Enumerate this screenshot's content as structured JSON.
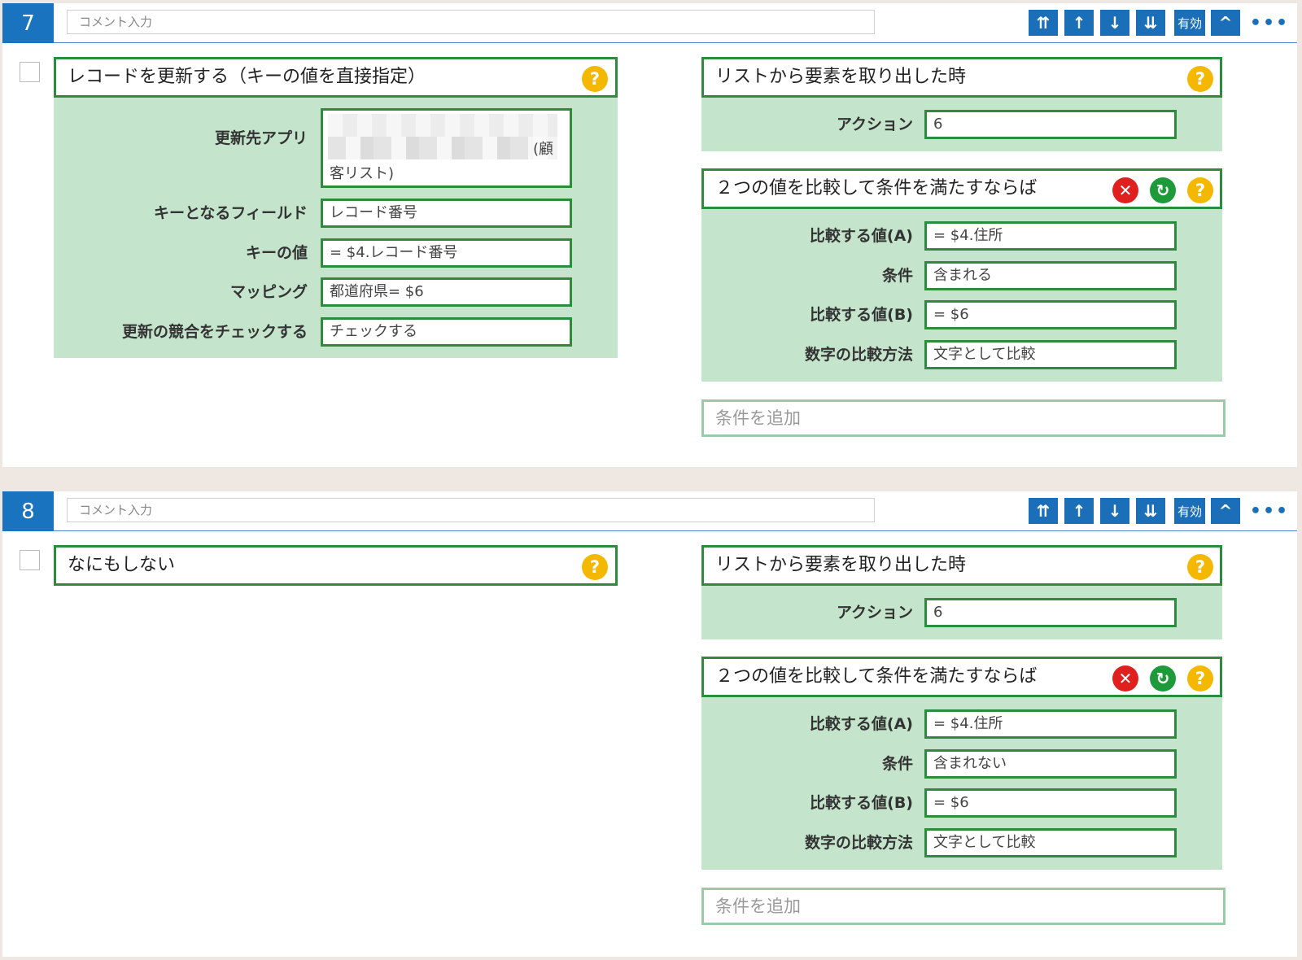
{
  "blocks": [
    {
      "number": "7",
      "comment_placeholder": "コメント入力",
      "toolbar": {
        "move_top": "⇈",
        "move_up": "↑",
        "move_down": "↓",
        "move_bottom": "⇊",
        "valid": "有効",
        "collapse": "^",
        "more": "•••"
      },
      "action": {
        "title": "レコードを更新する（キーの値を直接指定）",
        "rows": [
          {
            "label": "更新先アプリ",
            "value_tail": "(顧",
            "value_line2": "客リスト)"
          },
          {
            "label": "キーとなるフィールド",
            "value": "レコード番号"
          },
          {
            "label": "キーの値",
            "value": "= $4.レコード番号"
          },
          {
            "label": "マッピング",
            "value": "都道府県= $6"
          },
          {
            "label": "更新の競合をチェックする",
            "value": "チェックする"
          }
        ]
      },
      "trigger": {
        "title": "リストから要素を取り出した時",
        "label": "アクション",
        "value": "6"
      },
      "condition": {
        "title": "２つの値を比較して条件を満たすならば",
        "rows": [
          {
            "label": "比較する値(A)",
            "value": "= $4.住所"
          },
          {
            "label": "条件",
            "value": "含まれる"
          },
          {
            "label": "比較する値(B)",
            "value": "= $6"
          },
          {
            "label": "数字の比較方法",
            "value": "文字として比較"
          }
        ]
      },
      "add_condition": "条件を追加"
    },
    {
      "number": "8",
      "comment_placeholder": "コメント入力",
      "toolbar": {
        "move_top": "⇈",
        "move_up": "↑",
        "move_down": "↓",
        "move_bottom": "⇊",
        "valid": "有効",
        "collapse": "^",
        "more": "•••"
      },
      "action": {
        "title": "なにもしない"
      },
      "trigger": {
        "title": "リストから要素を取り出した時",
        "label": "アクション",
        "value": "6"
      },
      "condition": {
        "title": "２つの値を比較して条件を満たすならば",
        "rows": [
          {
            "label": "比較する値(A)",
            "value": "= $4.住所"
          },
          {
            "label": "条件",
            "value": "含まれない"
          },
          {
            "label": "比較する値(B)",
            "value": "= $6"
          },
          {
            "label": "数字の比較方法",
            "value": "文字として比較"
          }
        ]
      },
      "add_condition": "条件を追加"
    }
  ],
  "icons": {
    "help": "question-icon",
    "delete": "close-icon",
    "refresh": "refresh-icon"
  },
  "colors": {
    "accent": "#1a73bf",
    "panel_border": "#2e8b3e",
    "panel_fill": "#c4e4cc",
    "help": "#f5b800",
    "delete": "#e0201f",
    "refresh": "#1f9a3a"
  }
}
